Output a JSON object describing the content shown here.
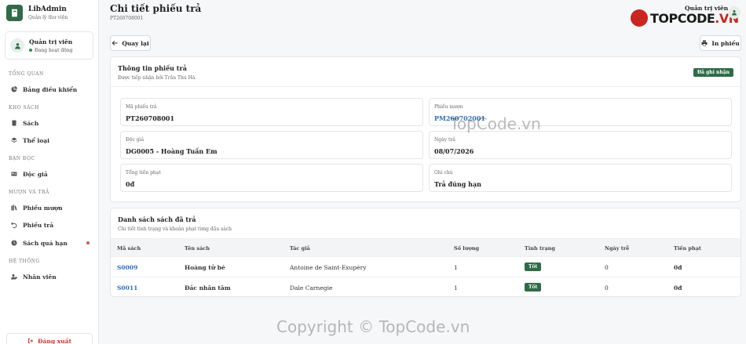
{
  "brand": {
    "name": "LibAdmin",
    "subtitle": "Quản lý thư viện"
  },
  "user": {
    "name": "Quản trị viên",
    "status": "Đang hoạt động"
  },
  "sidebar": {
    "sections": [
      {
        "label": "TỔNG QUAN",
        "items": [
          {
            "label": "Bảng điều khiển",
            "icon": "pie-chart-icon"
          }
        ]
      },
      {
        "label": "KHO SÁCH",
        "items": [
          {
            "label": "Sách",
            "icon": "book-icon"
          },
          {
            "label": "Thể loại",
            "icon": "layers-icon"
          }
        ]
      },
      {
        "label": "BẠN ĐỌC",
        "items": [
          {
            "label": "Độc giả",
            "icon": "id-card-icon"
          }
        ]
      },
      {
        "label": "MƯỢN VÀ TRẢ",
        "items": [
          {
            "label": "Phiếu mượn",
            "icon": "books-icon"
          },
          {
            "label": "Phiếu trả",
            "icon": "undo-icon"
          },
          {
            "label": "Sách quá hạn",
            "icon": "clock-icon"
          }
        ]
      },
      {
        "label": "HỆ THỐNG",
        "items": [
          {
            "label": "Nhân viên",
            "icon": "users-gear-icon"
          }
        ]
      }
    ],
    "logout_label": "Đăng xuất"
  },
  "header": {
    "title": "Chi tiết phiếu trả",
    "code": "PT260708001",
    "admin_label": "Quản trị viên"
  },
  "watermark": {
    "logo_left": "TOPCODE",
    "logo_right": ".VN",
    "text_center": "TopCode.vn",
    "text_bottom": "Copyright © TopCode.vn"
  },
  "actions": {
    "back": "Quay lại",
    "print": "In phiếu"
  },
  "info": {
    "title": "Thông tin phiếu trả",
    "subtitle": "Được tiếp nhận bởi Trần Thu Hà",
    "badge": "Đã ghi nhận",
    "fields": {
      "code_label": "Mã phiếu trả",
      "code_value": "PT260708001",
      "loan_label": "Phiếu mượn",
      "loan_value": "PM260702001",
      "reader_label": "Độc giả",
      "reader_value": "DG0005 - Hoàng Tuấn Em",
      "date_label": "Ngày trả",
      "date_value": "08/07/2026",
      "fine_label": "Tổng tiền phạt",
      "fine_value": "0đ",
      "note_label": "Ghi chú",
      "note_value": "Trả đúng hạn"
    }
  },
  "list": {
    "title": "Danh sách sách đã trả",
    "subtitle": "Chi tiết tình trạng và khoản phạt từng đầu sách",
    "columns": [
      "Mã sách",
      "Tên sách",
      "Tác giả",
      "Số lượng",
      "Tình trạng",
      "Ngày trễ",
      "Tiền phạt"
    ],
    "rows": [
      {
        "code": "S0009",
        "name": "Hoàng tử bé",
        "author": "Antoine de Saint-Exupéry",
        "qty": "1",
        "status": "Tốt",
        "late": "0",
        "fine": "0đ"
      },
      {
        "code": "S0011",
        "name": "Đắc nhân tâm",
        "author": "Dale Carnegie",
        "qty": "1",
        "status": "Tốt",
        "late": "0",
        "fine": "0đ"
      }
    ]
  },
  "colors": {
    "brand_green": "#2f6b47",
    "link_blue": "#2e6fb8",
    "logout_red": "#c83a32"
  }
}
